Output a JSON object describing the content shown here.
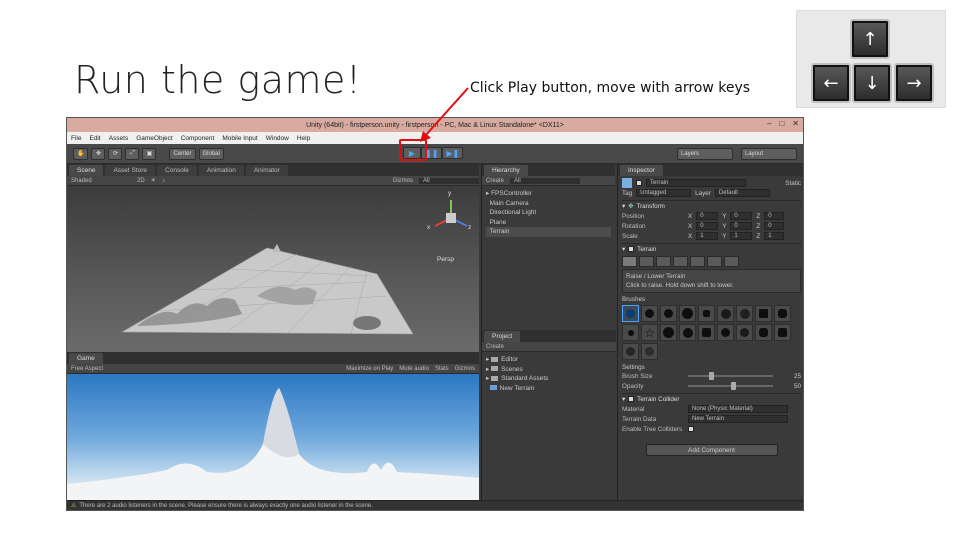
{
  "slide": {
    "title": "Run the game!",
    "caption": "Click Play button, move with arrow keys",
    "accent_color": "#e01010"
  },
  "arrow_keys": {
    "up": "↑",
    "left": "←",
    "down": "↓",
    "right": "→"
  },
  "window": {
    "title": "Unity (64bit) - firstperson.unity - firstperson - PC, Mac & Linux Standalone* <DX11>",
    "controls": [
      "–",
      "□",
      "✕"
    ],
    "menu": [
      "File",
      "Edit",
      "Assets",
      "GameObject",
      "Component",
      "Mobile Input",
      "Window",
      "Help"
    ]
  },
  "toolbar": {
    "pivot": "Center",
    "space": "Global",
    "play": "▶",
    "pause": "❚❚",
    "step": "▶❚",
    "layers": "Layers",
    "layout": "Layout"
  },
  "scene": {
    "tabs": [
      "Scene",
      "Asset Store",
      "Console",
      "Animation",
      "Animator"
    ],
    "shading": "Shaded",
    "mode": "2D",
    "gizmos": "Gizmos",
    "search": "All",
    "persp": "Persp",
    "axes": {
      "x": "x",
      "y": "y",
      "z": "z"
    }
  },
  "game": {
    "tab": "Game",
    "aspect": "Free Aspect",
    "options": [
      "Maximize on Play",
      "Mute audio",
      "Stats",
      "Gizmos"
    ]
  },
  "hierarchy": {
    "tab": "Hierarchy",
    "create": "Create",
    "search": "All",
    "items": [
      "FPSController",
      "Main Camera",
      "Directional Light",
      "Plane",
      "Terrain"
    ],
    "selected_index": 4
  },
  "project": {
    "tab": "Project",
    "create": "Create",
    "folders": [
      "Editor",
      "Scenes",
      "Standard Assets"
    ],
    "asset": "New Terrain"
  },
  "inspector": {
    "tab": "Inspector",
    "object_name": "Terrain",
    "static_label": "Static",
    "tag_label": "Tag",
    "tag_value": "Untagged",
    "layer_label": "Layer",
    "layer_value": "Default",
    "transform": {
      "title": "Transform",
      "rows": [
        {
          "label": "Position",
          "x": "0",
          "y": "0",
          "z": "0"
        },
        {
          "label": "Rotation",
          "x": "0",
          "y": "0",
          "z": "0"
        },
        {
          "label": "Scale",
          "x": "1",
          "y": "1",
          "z": "1"
        }
      ]
    },
    "terrain": {
      "title": "Terrain",
      "tool_title": "Raise / Lower Terrain",
      "tool_help": "Click to raise. Hold down shift to lower.",
      "brushes_label": "Brushes",
      "settings_label": "Settings",
      "brush_size_label": "Brush Size",
      "brush_size": "25",
      "brush_size_fraction": 0.25,
      "opacity_label": "Opacity",
      "opacity": "50",
      "opacity_fraction": 0.5
    },
    "collider": {
      "title": "Terrain Collider",
      "material_label": "Material",
      "material_value": "None (Physic Material)",
      "data_label": "Terrain Data",
      "data_value": "New Terrain",
      "tree_label": "Enable Tree Colliders"
    },
    "add_component": "Add Component"
  },
  "status": "There are 2 audio listeners in the scene. Please ensure there is always exactly one audio listener in the scene."
}
